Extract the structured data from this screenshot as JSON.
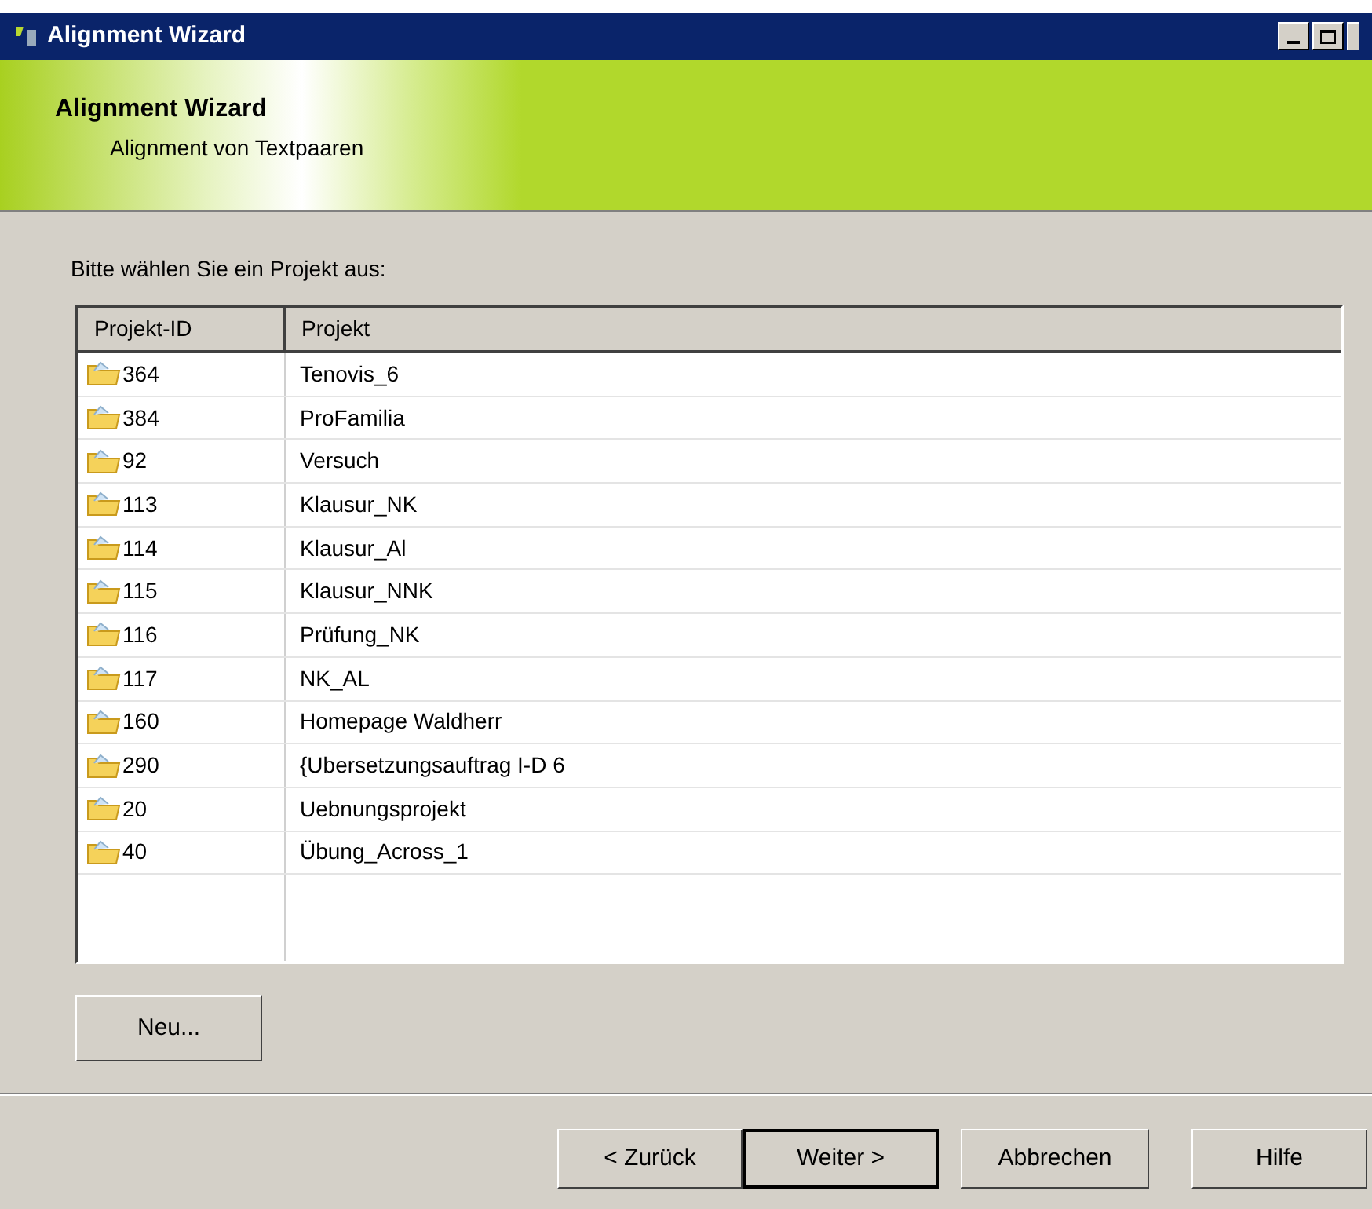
{
  "window": {
    "title": "Alignment Wizard"
  },
  "header": {
    "title": "Alignment Wizard",
    "subtitle": "Alignment von Textpaaren"
  },
  "prompt": "Bitte wählen Sie ein Projekt aus:",
  "table": {
    "columns": [
      "Projekt-ID",
      "Projekt"
    ],
    "rows": [
      {
        "id": "364",
        "name": "Tenovis_6"
      },
      {
        "id": "384",
        "name": "ProFamilia"
      },
      {
        "id": "92",
        "name": "Versuch"
      },
      {
        "id": "113",
        "name": "Klausur_NK"
      },
      {
        "id": "114",
        "name": "Klausur_Al"
      },
      {
        "id": "115",
        "name": "Klausur_NNK"
      },
      {
        "id": "116",
        "name": "Prüfung_NK"
      },
      {
        "id": "117",
        "name": "NK_AL"
      },
      {
        "id": "160",
        "name": "Homepage Waldherr"
      },
      {
        "id": "290",
        "name": "{Ubersetzungsauftrag I-D 6"
      },
      {
        "id": "20",
        "name": "Uebnungsprojekt"
      },
      {
        "id": "40",
        "name": "Übung_Across_1"
      }
    ]
  },
  "new_button": "Neu...",
  "buttons": [
    {
      "label": "< Zurück",
      "default": false
    },
    {
      "label": "Weiter >",
      "default": true
    },
    {
      "label": "Abbrechen",
      "default": false
    },
    {
      "label": "Hilfe",
      "default": false
    }
  ]
}
